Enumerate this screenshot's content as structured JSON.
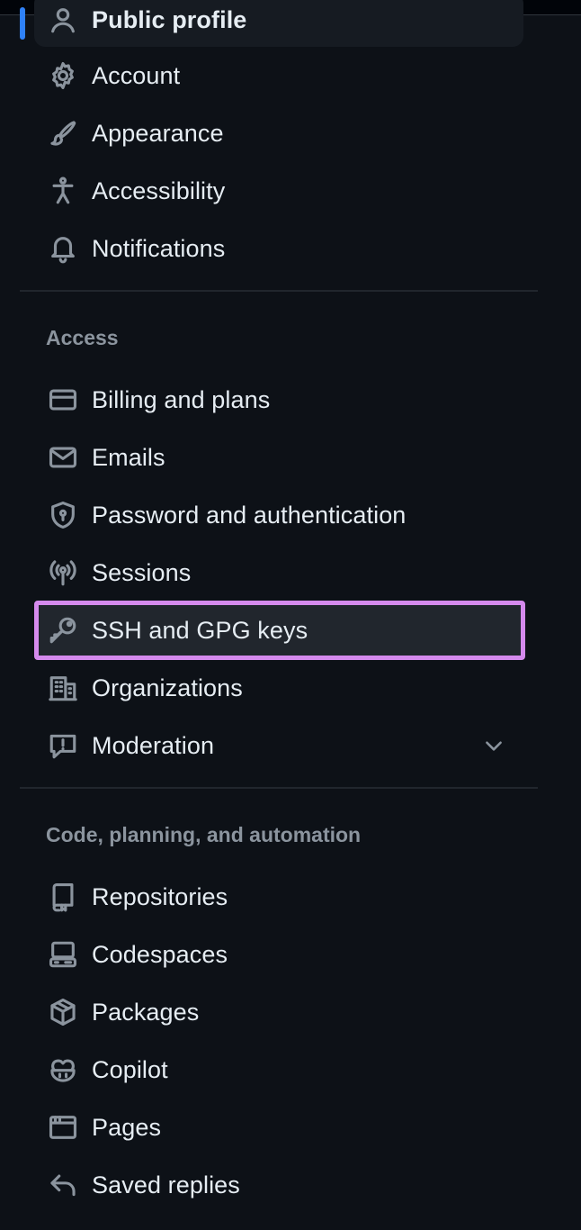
{
  "sidebar": {
    "top_items": [
      {
        "label": "Public profile",
        "icon": "person-icon"
      },
      {
        "label": "Account",
        "icon": "gear-icon"
      },
      {
        "label": "Appearance",
        "icon": "paintbrush-icon"
      },
      {
        "label": "Accessibility",
        "icon": "accessibility-icon"
      },
      {
        "label": "Notifications",
        "icon": "bell-icon"
      }
    ],
    "access": {
      "heading": "Access",
      "items": [
        {
          "label": "Billing and plans",
          "icon": "credit-card-icon"
        },
        {
          "label": "Emails",
          "icon": "mail-icon"
        },
        {
          "label": "Password and authentication",
          "icon": "shield-lock-icon"
        },
        {
          "label": "Sessions",
          "icon": "broadcast-icon"
        },
        {
          "label": "SSH and GPG keys",
          "icon": "key-icon"
        },
        {
          "label": "Organizations",
          "icon": "organization-icon"
        },
        {
          "label": "Moderation",
          "icon": "report-icon",
          "expand_icon": "chevron-down-icon"
        }
      ]
    },
    "code": {
      "heading": "Code, planning, and automation",
      "items": [
        {
          "label": "Repositories",
          "icon": "repo-icon"
        },
        {
          "label": "Codespaces",
          "icon": "codespaces-icon"
        },
        {
          "label": "Packages",
          "icon": "package-icon"
        },
        {
          "label": "Copilot",
          "icon": "copilot-icon"
        },
        {
          "label": "Pages",
          "icon": "browser-icon"
        },
        {
          "label": "Saved replies",
          "icon": "reply-icon"
        }
      ]
    }
  },
  "colors": {
    "background": "#0d1117",
    "text": "#e6edf3",
    "muted": "#8b949e",
    "highlight_border": "#d58aed",
    "active_indicator": "#2f81f7"
  }
}
